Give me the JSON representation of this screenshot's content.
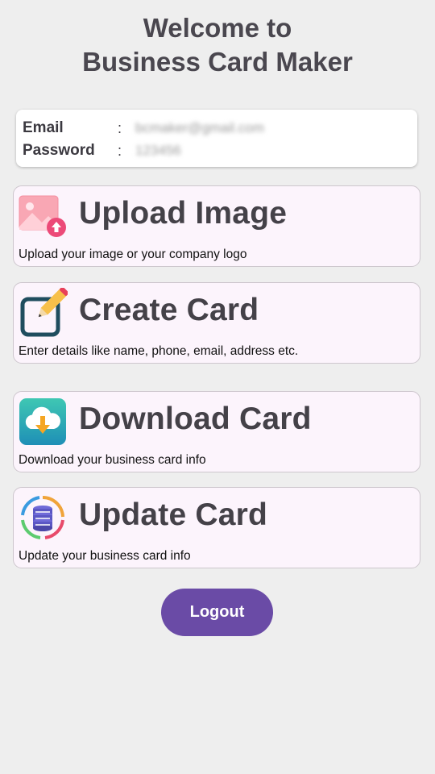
{
  "header": {
    "title_line1": "Welcome to",
    "title_line2": "Business Card Maker"
  },
  "credentials": {
    "email_label": "Email",
    "password_label": "Password",
    "separator": ":",
    "email_value": "bcmaker@gmail.com",
    "password_value": "123456"
  },
  "actions": [
    {
      "title": "Upload Image",
      "description": "Upload your image or your company logo",
      "icon": "upload-image-icon"
    },
    {
      "title": "Create Card",
      "description": "Enter details like name, phone, email, address etc.",
      "icon": "edit-icon"
    },
    {
      "title": "Download Card",
      "description": "Download your business card info",
      "icon": "cloud-download-icon"
    },
    {
      "title": "Update Card",
      "description": "Update your business card info",
      "icon": "database-sync-icon"
    }
  ],
  "logout_label": "Logout",
  "colors": {
    "background": "#eeeeee",
    "card_background": "#fcf4fc",
    "primary": "#6a4ba6",
    "title_text": "#4a474f"
  }
}
